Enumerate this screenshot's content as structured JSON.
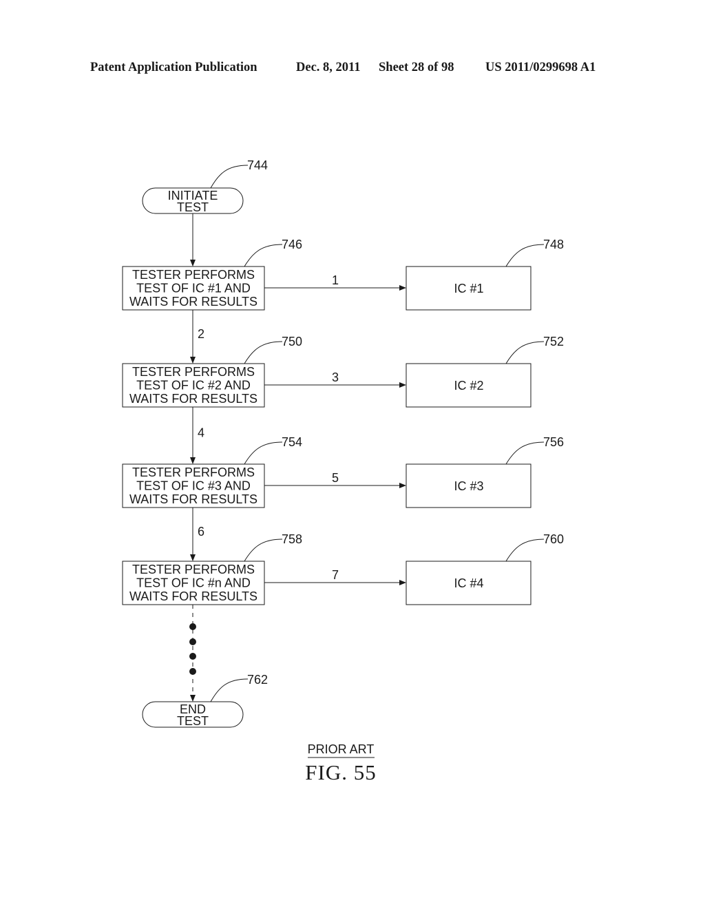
{
  "header": {
    "publication": "Patent Application Publication",
    "date": "Dec. 8, 2011",
    "sheet": "Sheet 28 of 98",
    "number": "US 2011/0299698 A1"
  },
  "flowchart": {
    "start": {
      "lines": [
        "INITIATE",
        "TEST"
      ],
      "ref": "744"
    },
    "steps": [
      {
        "lines": [
          "TESTER PERFORMS",
          "TEST OF IC #1 AND",
          "WAITS FOR RESULTS"
        ],
        "ref": "746",
        "arrow_label": "1",
        "target": {
          "label": "IC #1",
          "ref": "748"
        },
        "down_label": "2"
      },
      {
        "lines": [
          "TESTER PERFORMS",
          "TEST OF IC #2 AND",
          "WAITS FOR RESULTS"
        ],
        "ref": "750",
        "arrow_label": "3",
        "target": {
          "label": "IC #2",
          "ref": "752"
        },
        "down_label": "4"
      },
      {
        "lines": [
          "TESTER PERFORMS",
          "TEST OF IC #3 AND",
          "WAITS FOR RESULTS"
        ],
        "ref": "754",
        "arrow_label": "5",
        "target": {
          "label": "IC #3",
          "ref": "756"
        },
        "down_label": "6"
      },
      {
        "lines": [
          "TESTER PERFORMS",
          "TEST OF IC #n AND",
          "WAITS FOR RESULTS"
        ],
        "ref": "758",
        "arrow_label": "7",
        "target": {
          "label": "IC #4",
          "ref": "760"
        },
        "down_label": ""
      }
    ],
    "end": {
      "lines": [
        "END",
        "TEST"
      ],
      "ref": "762"
    }
  },
  "caption": {
    "prior_art": "PRIOR ART",
    "figure": "FIG.  55"
  }
}
